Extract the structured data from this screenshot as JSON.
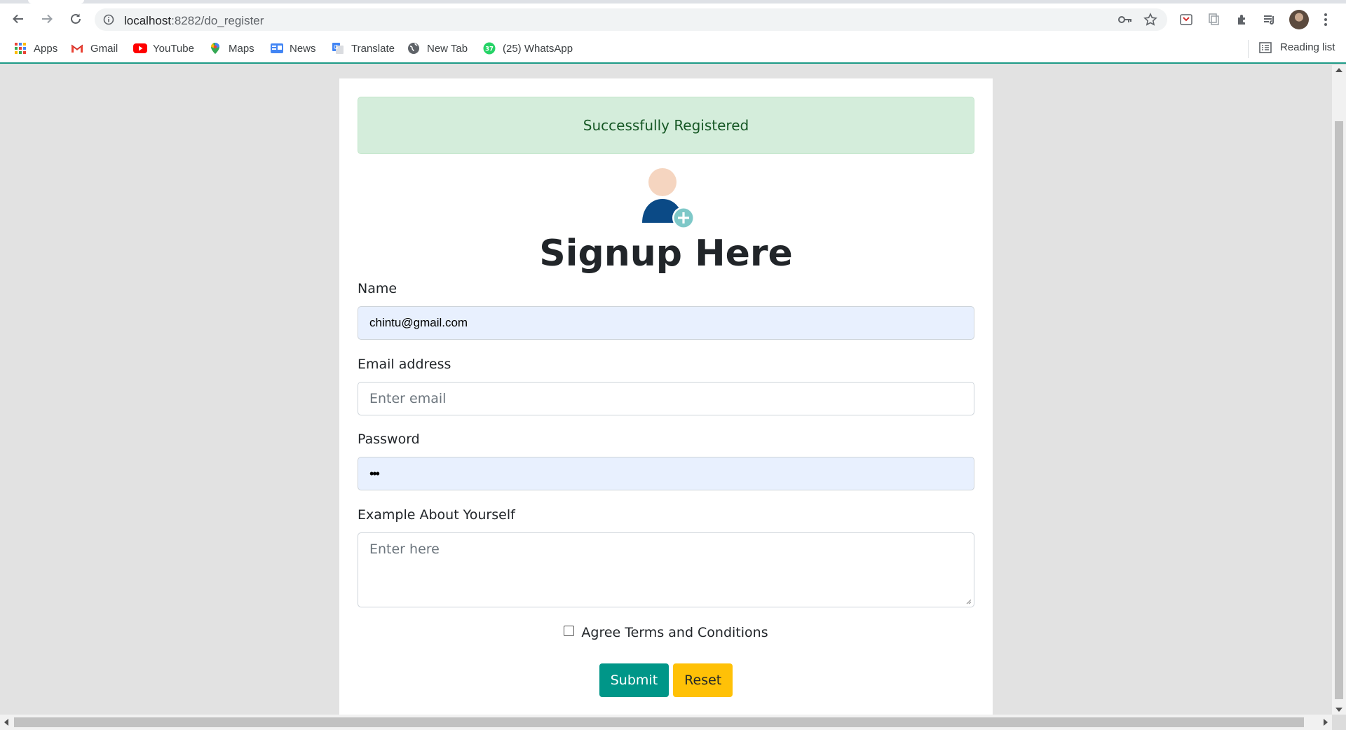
{
  "browser": {
    "url_host": "localhost",
    "url_path": ":8282/do_register",
    "bookmarks": [
      {
        "label": "Apps",
        "icon": "apps-grid-icon"
      },
      {
        "label": "Gmail",
        "icon": "gmail-icon"
      },
      {
        "label": "YouTube",
        "icon": "youtube-icon"
      },
      {
        "label": "Maps",
        "icon": "maps-pin-icon"
      },
      {
        "label": "News",
        "icon": "news-icon"
      },
      {
        "label": "Translate",
        "icon": "translate-icon"
      },
      {
        "label": "New Tab",
        "icon": "globe-icon"
      },
      {
        "label": "(25) WhatsApp",
        "icon": "whatsapp-icon",
        "badge": "37"
      }
    ],
    "reading_list": "Reading list"
  },
  "form": {
    "alert": "Successfully Registered",
    "title": "Signup Here",
    "name_label": "Name",
    "name_value": "chintu@gmail.com",
    "email_label": "Email address",
    "email_placeholder": "Enter email",
    "password_label": "Password",
    "password_value": "•••",
    "about_label": "Example About Yourself",
    "about_placeholder": "Enter here",
    "agree_label": "Agree Terms and Conditions",
    "submit_label": "Submit",
    "reset_label": "Reset"
  },
  "colors": {
    "alert_bg": "#d4eddb",
    "alert_text": "#155724",
    "submit_bg": "#009688",
    "reset_bg": "#ffc107",
    "autofill_bg": "#e8f0fe"
  }
}
